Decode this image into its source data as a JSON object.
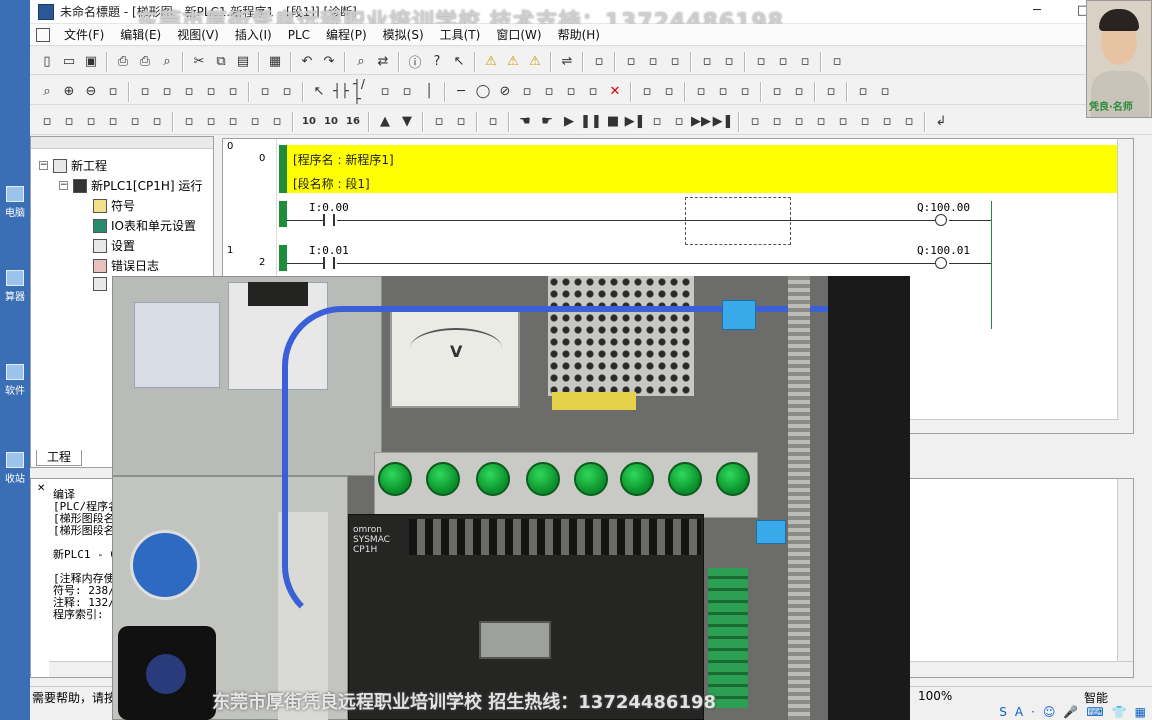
{
  "window": {
    "title": "未命名標題 - [梯形图 - 新PLC1.新程序1 - [段1]] [诊断]",
    "controls": [
      "─",
      "□",
      "✕"
    ]
  },
  "watermark": {
    "top": "东莞市厚街凭良远程职业培训学校  技术支持：13724486198",
    "bottom": "东莞市厚街凭良远程职业培训学校  招生热线：13724486198"
  },
  "webcam": {
    "tag": "凭良·名师"
  },
  "desktop": {
    "items": [
      {
        "label": "电脑"
      },
      {
        "label": "算器"
      },
      {
        "label": "软件"
      },
      {
        "label": "收站"
      }
    ]
  },
  "menu": {
    "items": [
      "文件(F)",
      "编辑(E)",
      "视图(V)",
      "插入(I)",
      "PLC",
      "编程(P)",
      "模拟(S)",
      "工具(T)",
      "窗口(W)",
      "帮助(H)"
    ]
  },
  "toolbar_icons": {
    "row1": [
      "new-file-icon",
      "open-folder-icon",
      "save-icon",
      "sep",
      "preview-icon",
      "print-icon",
      "print-preview-icon",
      "sep",
      "cut-icon",
      "copy-icon",
      "paste-icon",
      "sep",
      "clear-icon",
      "sep",
      "undo-icon",
      "redo-icon",
      "sep",
      "find-icon",
      "replace-icon",
      "sep",
      "properties-icon",
      "help-icon",
      "context-help-icon",
      "sep",
      "warning-icon",
      "warning-icon",
      "warning-icon",
      "sep",
      "online-icon",
      "sep",
      "transfer-icon",
      "sep",
      "download-icon",
      "upload-icon",
      "compare-icon",
      "sep",
      "monitor-icon",
      "settings-icon",
      "sep",
      "window-icon",
      "window-icon",
      "window-icon",
      "sep",
      "network-icon"
    ],
    "row2": [
      "zoom-icon",
      "zoom-in-icon",
      "zoom-out-icon",
      "zoom-fit-icon",
      "sep",
      "grid-icon",
      "comment-icon",
      "list-icon",
      "rung-icon",
      "tree-icon",
      "sep",
      "table-icon",
      "ct-icon",
      "sep",
      "select-icon",
      "no-contact-icon",
      "nc-contact-icon",
      "or-contact-icon",
      "or-nc-icon",
      "vertical-line-icon",
      "sep",
      "horizontal-line-icon",
      "coil-icon",
      "nc-coil-icon",
      "instruction-icon",
      "block-icon",
      "jump-icon",
      "line-icon",
      "delete-line-icon",
      "sep",
      "online-edit-icon",
      "transfer-icon",
      "sep",
      "cross-ref-icon",
      "io-icon",
      "memory-icon",
      "sep",
      "monitor-icon",
      "status-icon",
      "sep",
      "data-icon",
      "sep",
      "align-left-icon",
      "align-right-icon"
    ],
    "row3": [
      "window-a-icon",
      "window-b-icon",
      "window-c-icon",
      "window-d-icon",
      "window-e-icon",
      "window-f-icon",
      "sep",
      "block-a-icon",
      "block-b-icon",
      "block-c-icon",
      "block-d-icon",
      "block-e-icon",
      "sep",
      "set-10-icon",
      "set-10b-icon",
      "set-16-icon",
      "sep",
      "up-icon",
      "down-icon",
      "sep",
      "sim-a-icon",
      "sim-b-icon",
      "sep",
      "sim-c-icon",
      "sep",
      "hand-icon",
      "hand2-icon",
      "play-icon",
      "pause-icon",
      "stop-icon",
      "step-icon",
      "step2-icon",
      "step3-icon",
      "fast-icon",
      "end-icon",
      "sep",
      "ladder-a-icon",
      "ladder-b-icon",
      "ladder-c-icon",
      "ladder-d-icon",
      "ladder-e-icon",
      "ladder-f-icon",
      "ladder-g-icon",
      "ladder-h-icon",
      "sep",
      "return-icon"
    ]
  },
  "toolbar_text": {
    "set10": "10",
    "set10b": "10",
    "set16": "16"
  },
  "project_tree": {
    "root": "新工程",
    "plc": "新PLC1[CP1H] 运行",
    "children": [
      "符号",
      "IO表和单元设置",
      "设置",
      "错误日志"
    ],
    "tab": "工程"
  },
  "ladder": {
    "header": {
      "program_name": "[程序名 : 新程序1]",
      "section_name": "[段名称 : 段1]"
    },
    "rungs": [
      {
        "index": "0",
        "step": "0",
        "contact": "I:0.00",
        "coil": "Q:100.00"
      },
      {
        "index": "1",
        "step": "2",
        "contact": "I:0.01",
        "coil": "Q:100.01"
      }
    ]
  },
  "output": {
    "lines": [
      "编译",
      "[PLC/程序名",
      "[梯形图段名",
      "[梯形图段名",
      "",
      "新PLC1 - 0",
      "",
      "[注释内存使",
      "符号: 238/",
      "注释: 132/",
      "程序索引:"
    ]
  },
  "statusbar": {
    "help": "需要帮助，请按F1",
    "zoom": "100%",
    "mode": "智能",
    "tray": [
      "S",
      "A",
      "·",
      "☺",
      "🎤",
      "⌨",
      "👕",
      "▦"
    ]
  },
  "video": {
    "plc_brand": "omron\nSYSMAC\nCP1H",
    "meter_unit": "V"
  }
}
